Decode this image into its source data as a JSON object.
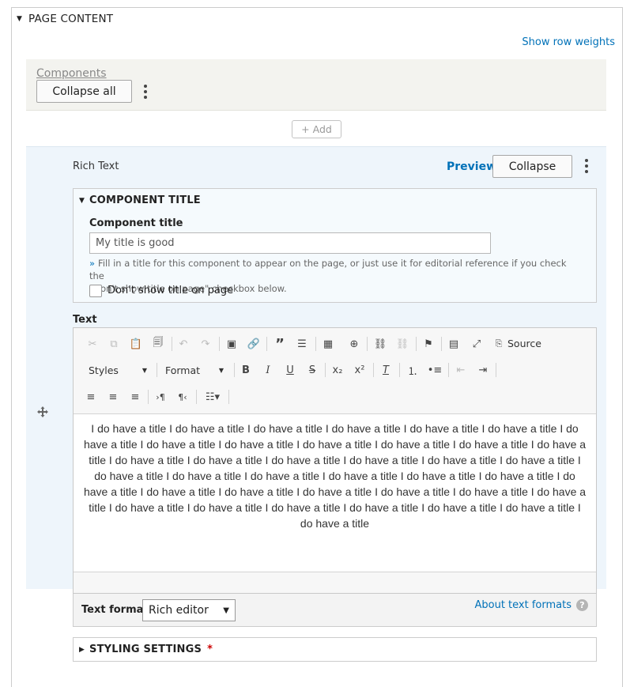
{
  "page_content": {
    "title": "PAGE CONTENT",
    "show_row_weights": "Show row weights"
  },
  "components": {
    "label": "Components",
    "collapse_all": "Collapse all",
    "add_label": "+ Add"
  },
  "item": {
    "type": "Rich Text",
    "preview": "Preview",
    "collapse": "Collapse",
    "component_title_section": "COMPONENT TITLE",
    "component_title_label": "Component title",
    "component_title_value": "My title is good",
    "component_title_help_line1": "Fill in a title for this component to appear on the page, or just use it for editorial reference if you check the",
    "component_title_help_line2": "\"Don't show title on page\" checkbox below.",
    "dont_show_title_label": "Don't show title on page",
    "dont_show_title_checked": false,
    "text_label": "Text",
    "editor": {
      "styles_combo": "Styles",
      "format_combo": "Format",
      "source_label": "Source",
      "toolbar_icons": [
        "cut-icon",
        "copy-icon",
        "paste-icon",
        "paste-from-word-icon",
        "undo-icon",
        "redo-icon",
        "insert-media-icon",
        "link-icon",
        "blockquote-icon",
        "horizontal-line-icon",
        "table-icon",
        "link-plus-icon",
        "anchor-link-icon",
        "unlink-icon",
        "flag-icon",
        "show-blocks-icon",
        "maximize-icon",
        "source-icon",
        "bold-icon",
        "italic-icon",
        "underline-icon",
        "strikethrough-icon",
        "subscript-icon",
        "superscript-icon",
        "remove-format-icon",
        "numbered-list-icon",
        "bulleted-list-icon",
        "decrease-indent-icon",
        "increase-indent-icon",
        "align-left-icon",
        "align-center-icon",
        "align-right-icon",
        "ltr-icon",
        "rtl-icon",
        "paragraph-format-icon"
      ],
      "content": "I do have a title I do have a title I do have a title I do have a title I do have a title I do have a title I do have a title I do have a title I do have a title I do have a title I do have a title I do have a title I do have a title I do have a title I do have a title I do have a title I do have a title I do have a title I do have a title I do have a title I do have a title I do have a title I do have a title I do have a title I do have a title I do have a title I do have a title I do have a title I do have a title I do have a title I do have a title I do have a title I do have a title I do have a title I do have a title I do have a title I do have a title I do have a title I do have a title"
    },
    "text_format_label": "Text format",
    "text_format_value": "Rich editor",
    "about_text_formats": "About text formats",
    "styling_settings": "STYLING SETTINGS",
    "required_marker": "*"
  },
  "colors": {
    "link": "#0071b8",
    "required": "#cc0000",
    "item_background": "#eef5fb"
  }
}
